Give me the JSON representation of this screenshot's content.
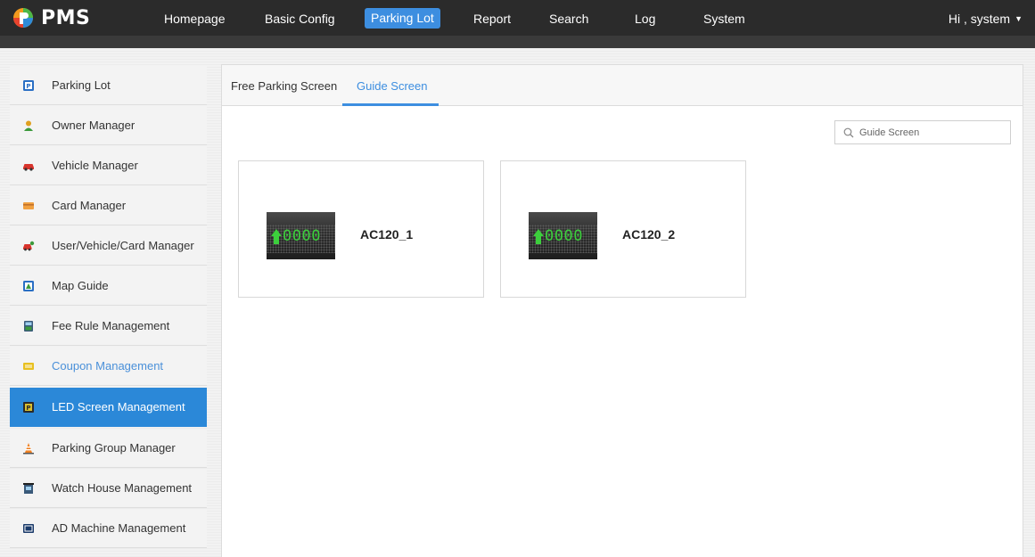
{
  "app": {
    "name": "PMS"
  },
  "nav": {
    "items": [
      {
        "label": "Homepage"
      },
      {
        "label": "Basic Config"
      },
      {
        "label": "Parking Lot",
        "active": true
      },
      {
        "label": "Report"
      },
      {
        "label": "Search"
      },
      {
        "label": "Log"
      },
      {
        "label": "System"
      }
    ],
    "user_label": "Hi , system",
    "caret": "▼"
  },
  "sidebar": {
    "items": [
      {
        "label": "Parking Lot",
        "icon": "parking-icon"
      },
      {
        "label": "Owner Manager",
        "icon": "owner-icon"
      },
      {
        "label": "Vehicle Manager",
        "icon": "car-icon"
      },
      {
        "label": "Card Manager",
        "icon": "card-icon"
      },
      {
        "label": "User/Vehicle/Card Manager",
        "icon": "user-vehicle-card-icon"
      },
      {
        "label": "Map Guide",
        "icon": "map-guide-icon"
      },
      {
        "label": "Fee Rule Management",
        "icon": "fee-rule-icon"
      },
      {
        "label": "Coupon Management",
        "icon": "coupon-icon",
        "hover": true
      },
      {
        "label": "LED Screen Management",
        "icon": "led-screen-icon",
        "active": true
      },
      {
        "label": "Parking Group Manager",
        "icon": "parking-group-icon"
      },
      {
        "label": "Watch House Management",
        "icon": "watch-house-icon"
      },
      {
        "label": "AD Machine Management",
        "icon": "ad-machine-icon"
      }
    ]
  },
  "tabs": {
    "items": [
      {
        "label": "Free Parking Screen"
      },
      {
        "label": "Guide Screen",
        "active": true
      }
    ]
  },
  "search": {
    "placeholder": "Guide Screen"
  },
  "screens": [
    {
      "name": "AC120_1",
      "display": "0000"
    },
    {
      "name": "AC120_2",
      "display": "0000"
    }
  ],
  "colors": {
    "accent": "#3d8ee0",
    "active_sidebar": "#2b88d8",
    "topbar": "#2b2b2b",
    "led_green": "#3ccf3c"
  }
}
